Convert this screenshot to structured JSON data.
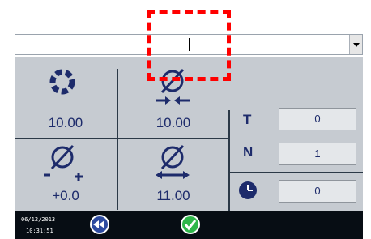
{
  "combo": {
    "value": "",
    "caret_visible": true
  },
  "cells": [
    {
      "id": "cell-1",
      "icon": "gear-ring-icon",
      "value": "10.00"
    },
    {
      "id": "cell-2",
      "icon": "diameter-inward-icon",
      "value": "10.00"
    },
    {
      "id": "cell-3",
      "icon": "diameter-tolerance-icon",
      "value": "+0.0"
    },
    {
      "id": "cell-4",
      "icon": "diameter-outward-icon",
      "value": "11.00"
    }
  ],
  "side": {
    "t": {
      "label": "T",
      "value": "0"
    },
    "n": {
      "label": "N",
      "value": "1"
    },
    "clock": {
      "icon": "clock-icon",
      "value": "0"
    }
  },
  "status": {
    "date": "06/12/2013",
    "time": "10:31:51"
  },
  "buttons": {
    "back_icon": "rewind-icon",
    "confirm_icon": "check-icon"
  },
  "colors": {
    "panel": "#c6cbd1",
    "accent_blue": "#1d2b6b",
    "selection": "#ff0000",
    "confirm_green": "#2fb64a"
  }
}
